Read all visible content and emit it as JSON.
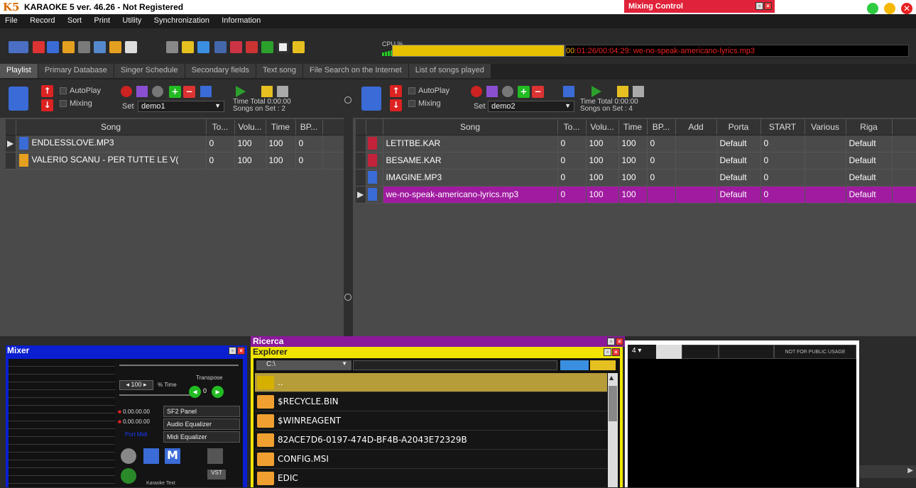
{
  "window": {
    "logo": "K5",
    "title": "KARAOKE 5   ver. 46.26 - Not Registered"
  },
  "mixing_control": {
    "title": "Mixing Control"
  },
  "menu": [
    "File",
    "Record",
    "Sort",
    "Print",
    "Utility",
    "Synchronization",
    "Information"
  ],
  "cpu_label": "CPU %",
  "timebar": {
    "prefix": "00",
    "text": ":01:26/00:04:29: we-no-speak-americano-lyrics.mp3"
  },
  "tabs": [
    "Playlist",
    "Primary Database",
    "Singer Schedule",
    "Secondary fields",
    "Text song",
    "File Search on the Internet",
    "List of songs played"
  ],
  "left": {
    "autoplay": "AutoPlay",
    "mixing": "Mixing",
    "set_label": "Set",
    "set_value": "demo1",
    "time_total": "Time Total  0:00:00",
    "songs_on_set": "Songs on Set : 2",
    "columns": [
      "Song",
      "To...",
      "Volu...",
      "Time",
      "BP..."
    ],
    "rows": [
      [
        "ENDLESSLOVE.MP3",
        "0",
        "100",
        "100",
        "0"
      ],
      [
        "VALERIO SCANU - PER TUTTE LE V(",
        "0",
        "100",
        "100",
        "0"
      ]
    ]
  },
  "right": {
    "autoplay": "AutoPlay",
    "mixing": "Mixing",
    "set_label": "Set",
    "set_value": "demo2",
    "time_total": "Time Total  0:00:00",
    "songs_on_set": "Songs on Set : 4",
    "columns": [
      "Song",
      "To...",
      "Volu...",
      "Time",
      "BP...",
      "Add",
      "Porta",
      "START",
      "Various",
      "Riga"
    ],
    "rows": [
      [
        "LETITBE.KAR",
        "0",
        "100",
        "100",
        "0",
        "",
        "Default",
        "0",
        "",
        "Default"
      ],
      [
        "BESAME.KAR",
        "0",
        "100",
        "100",
        "0",
        "",
        "Default",
        "0",
        "",
        "Default"
      ],
      [
        "IMAGINE.MP3",
        "0",
        "100",
        "100",
        "0",
        "",
        "Default",
        "0",
        "",
        "Default"
      ],
      [
        "we-no-speak-americano-lyrics.mp3",
        "0",
        "100",
        "100",
        "",
        "",
        "Default",
        "0",
        "",
        "Default"
      ]
    ]
  },
  "mixer": {
    "title": "Mixer",
    "tempo_value": "100",
    "tempo_label": "% Time",
    "transpose_label": "Transpose",
    "transpose_value": "0",
    "time1": "0.00.00.00",
    "time2": "0.00.00.00",
    "port_midi": "Port Midi",
    "sf2": "SF2 Panel",
    "audio_eq": "Audio Equalizer",
    "midi_eq": "Midi Equalizer",
    "vst": "VST",
    "karaoke_text": "Karaoke Text"
  },
  "ricerca": {
    "title": "Ricerca"
  },
  "explorer": {
    "title": "Explorer",
    "drive": "C:\\",
    "entries": [
      "..",
      "$RECYCLE.BIN",
      "$WINREAGENT",
      "82ACE7D6-0197-474D-BF4B-A2043E72329B",
      "CONFIG.MSI",
      "EDIC"
    ]
  },
  "video": {
    "channel": "4",
    "notice": "NOT FOR PUBLIC USAGE"
  },
  "colors": {
    "selected_row": "#a01ba0",
    "mixer": "#0a1fd0",
    "explorer": "#f0e400",
    "ricerca": "#8a1a9a",
    "mixing_control": "#e0223a"
  }
}
